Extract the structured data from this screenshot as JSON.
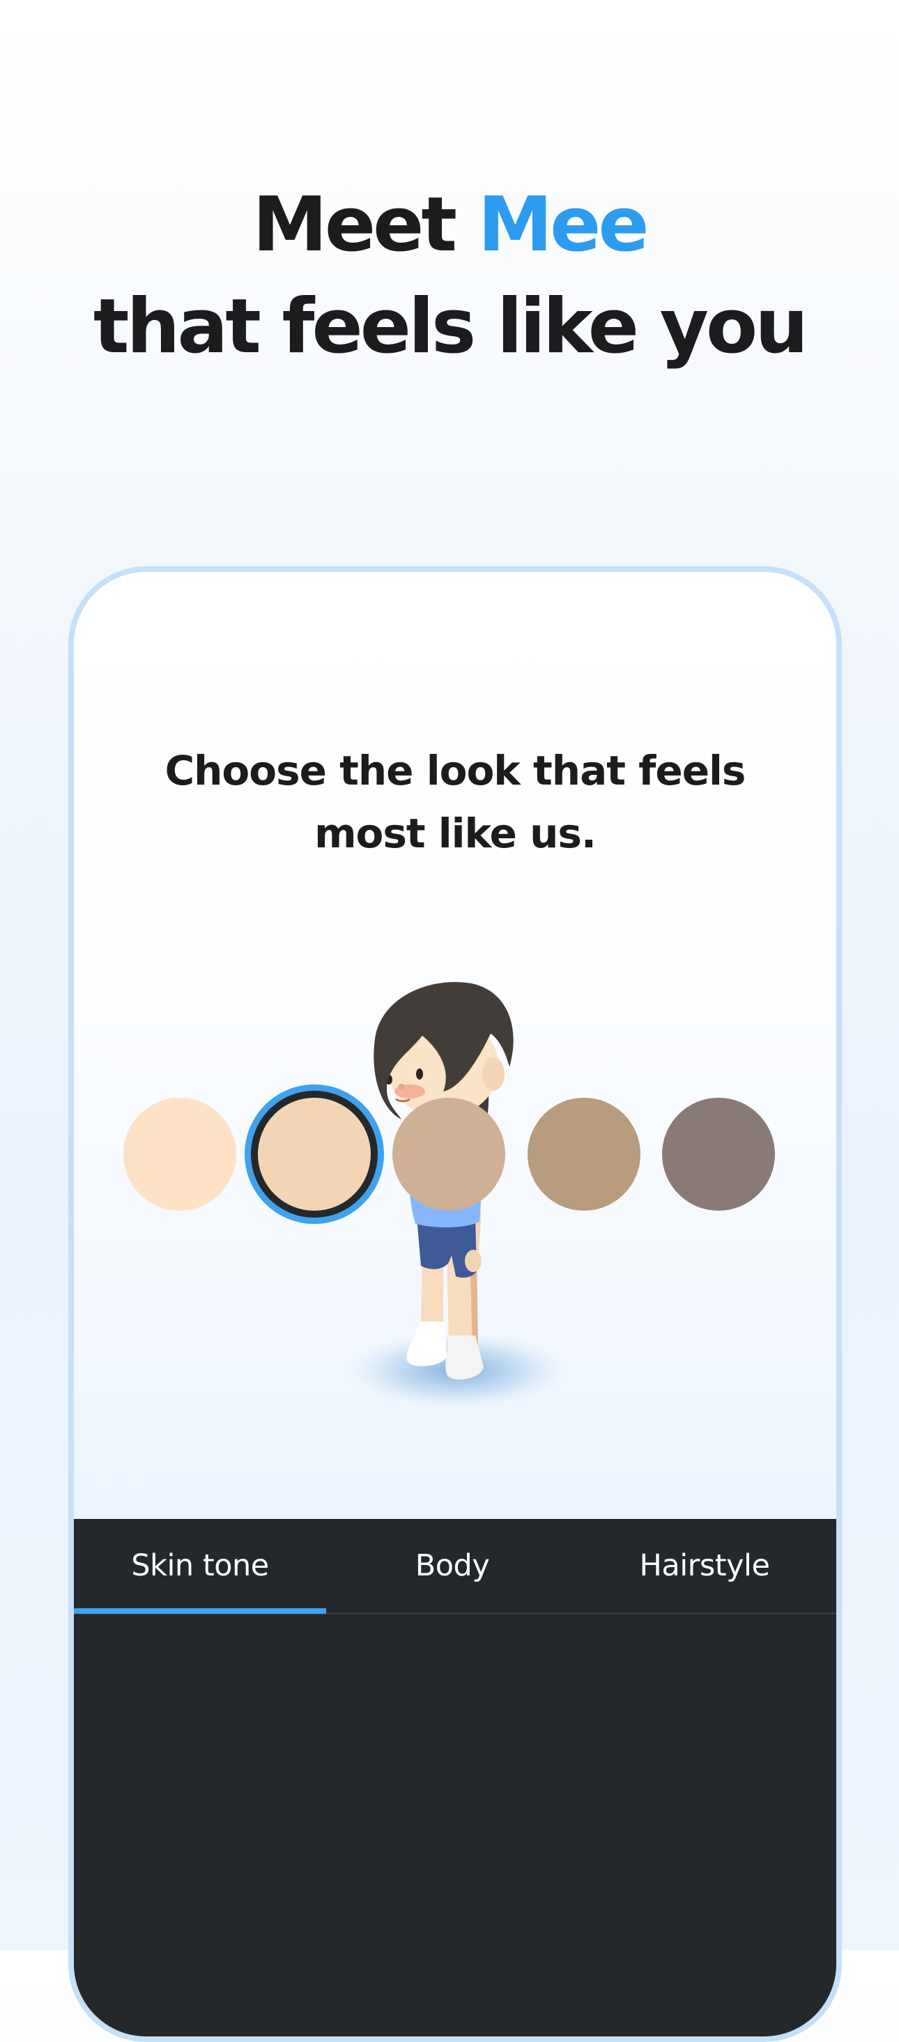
{
  "headline": {
    "prefix": "Meet ",
    "accent": "Mee",
    "line2": "that feels like you"
  },
  "prompt": {
    "line1": "Choose the look that feels",
    "line2": "most like us."
  },
  "tabs": [
    {
      "label": "Skin tone",
      "selected": true
    },
    {
      "label": "Body",
      "selected": false
    },
    {
      "label": "Hairstyle",
      "selected": false
    }
  ],
  "skin_tones": [
    {
      "color": "#fde2c8",
      "selected": false
    },
    {
      "color": "#f3d5b5",
      "selected": true
    },
    {
      "color": "#ceb097",
      "selected": false
    },
    {
      "color": "#b99b7e",
      "selected": false
    },
    {
      "color": "#8a7a76",
      "selected": false
    }
  ],
  "colors": {
    "accent": "#2d9cf0",
    "panel_bg": "#24282b",
    "tab_indicator": "#3ea2ef"
  }
}
